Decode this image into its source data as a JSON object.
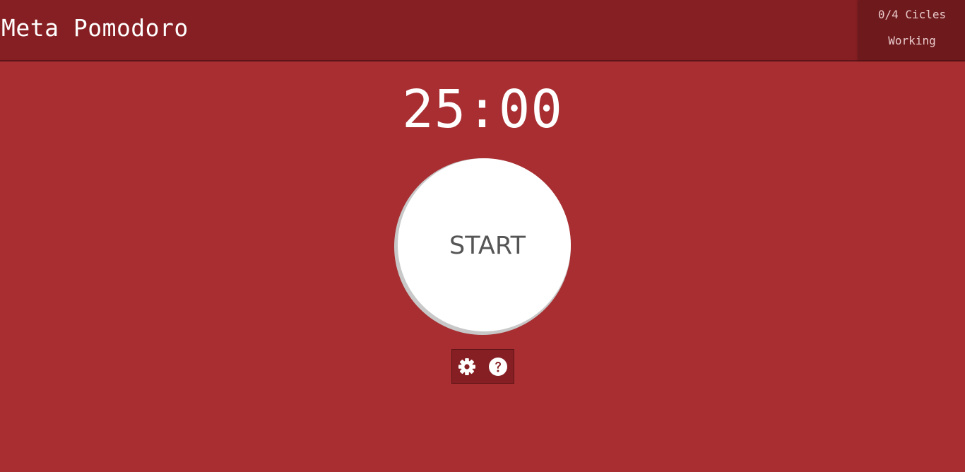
{
  "header": {
    "title": "Meta Pomodoro",
    "cycles": "0/4 Cicles",
    "mode": "Working"
  },
  "timer": {
    "display": "25:00"
  },
  "controls": {
    "start_label": "START",
    "settings_icon": "gear-icon",
    "help_icon": "question-circle-icon"
  },
  "colors": {
    "background": "#a82e31",
    "header": "#861f23",
    "status_panel": "#6e1a1d",
    "start_button": "#ffffff",
    "start_text": "#555555"
  }
}
